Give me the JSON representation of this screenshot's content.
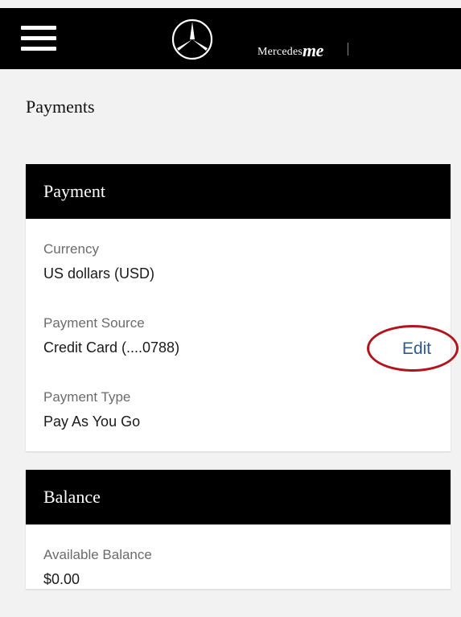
{
  "header": {
    "brand_text": "Mercedes",
    "brand_me": "me"
  },
  "page": {
    "title": "Payments"
  },
  "payment_card": {
    "title": "Payment",
    "currency_label": "Currency",
    "currency_value": "US dollars (USD)",
    "source_label": "Payment Source",
    "source_value": "Credit Card (....0788)",
    "edit_label": "Edit",
    "type_label": "Payment Type",
    "type_value": "Pay As You Go"
  },
  "balance_card": {
    "title": "Balance",
    "available_label": "Available Balance",
    "available_value": "$0.00"
  },
  "colors": {
    "header_bg": "#000000",
    "page_bg": "#f2f2f2",
    "link": "#2f5a8c",
    "annotation": "#b3131b"
  },
  "icons": {
    "menu": "hamburger-icon",
    "logo": "mercedes-star-icon"
  }
}
